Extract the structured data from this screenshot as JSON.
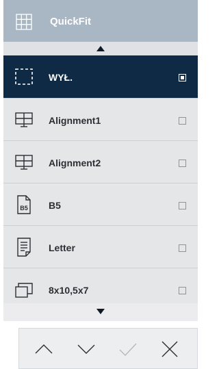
{
  "header": {
    "title": "QuickFit",
    "icon": "grid-icon"
  },
  "items": [
    {
      "label": "WYŁ.",
      "icon": "dashed-frame-icon",
      "selected": true
    },
    {
      "label": "Alignment1",
      "icon": "monitor-grid-icon",
      "selected": false
    },
    {
      "label": "Alignment2",
      "icon": "monitor-grid-icon",
      "selected": false
    },
    {
      "label": "B5",
      "icon": "b5-document-icon",
      "icon_text": "B5",
      "selected": false
    },
    {
      "label": "Letter",
      "icon": "letter-document-icon",
      "selected": false
    },
    {
      "label": "8x10,5x7",
      "icon": "stacked-frames-icon",
      "selected": false
    }
  ],
  "toolbar": {
    "buttons": [
      "up-chevron-icon",
      "down-chevron-icon",
      "check-icon",
      "close-icon"
    ]
  },
  "colors": {
    "header_bg": "#a9b6c4",
    "selected_bg": "#0e2a45",
    "panel_bg": "#dfe1e4"
  }
}
